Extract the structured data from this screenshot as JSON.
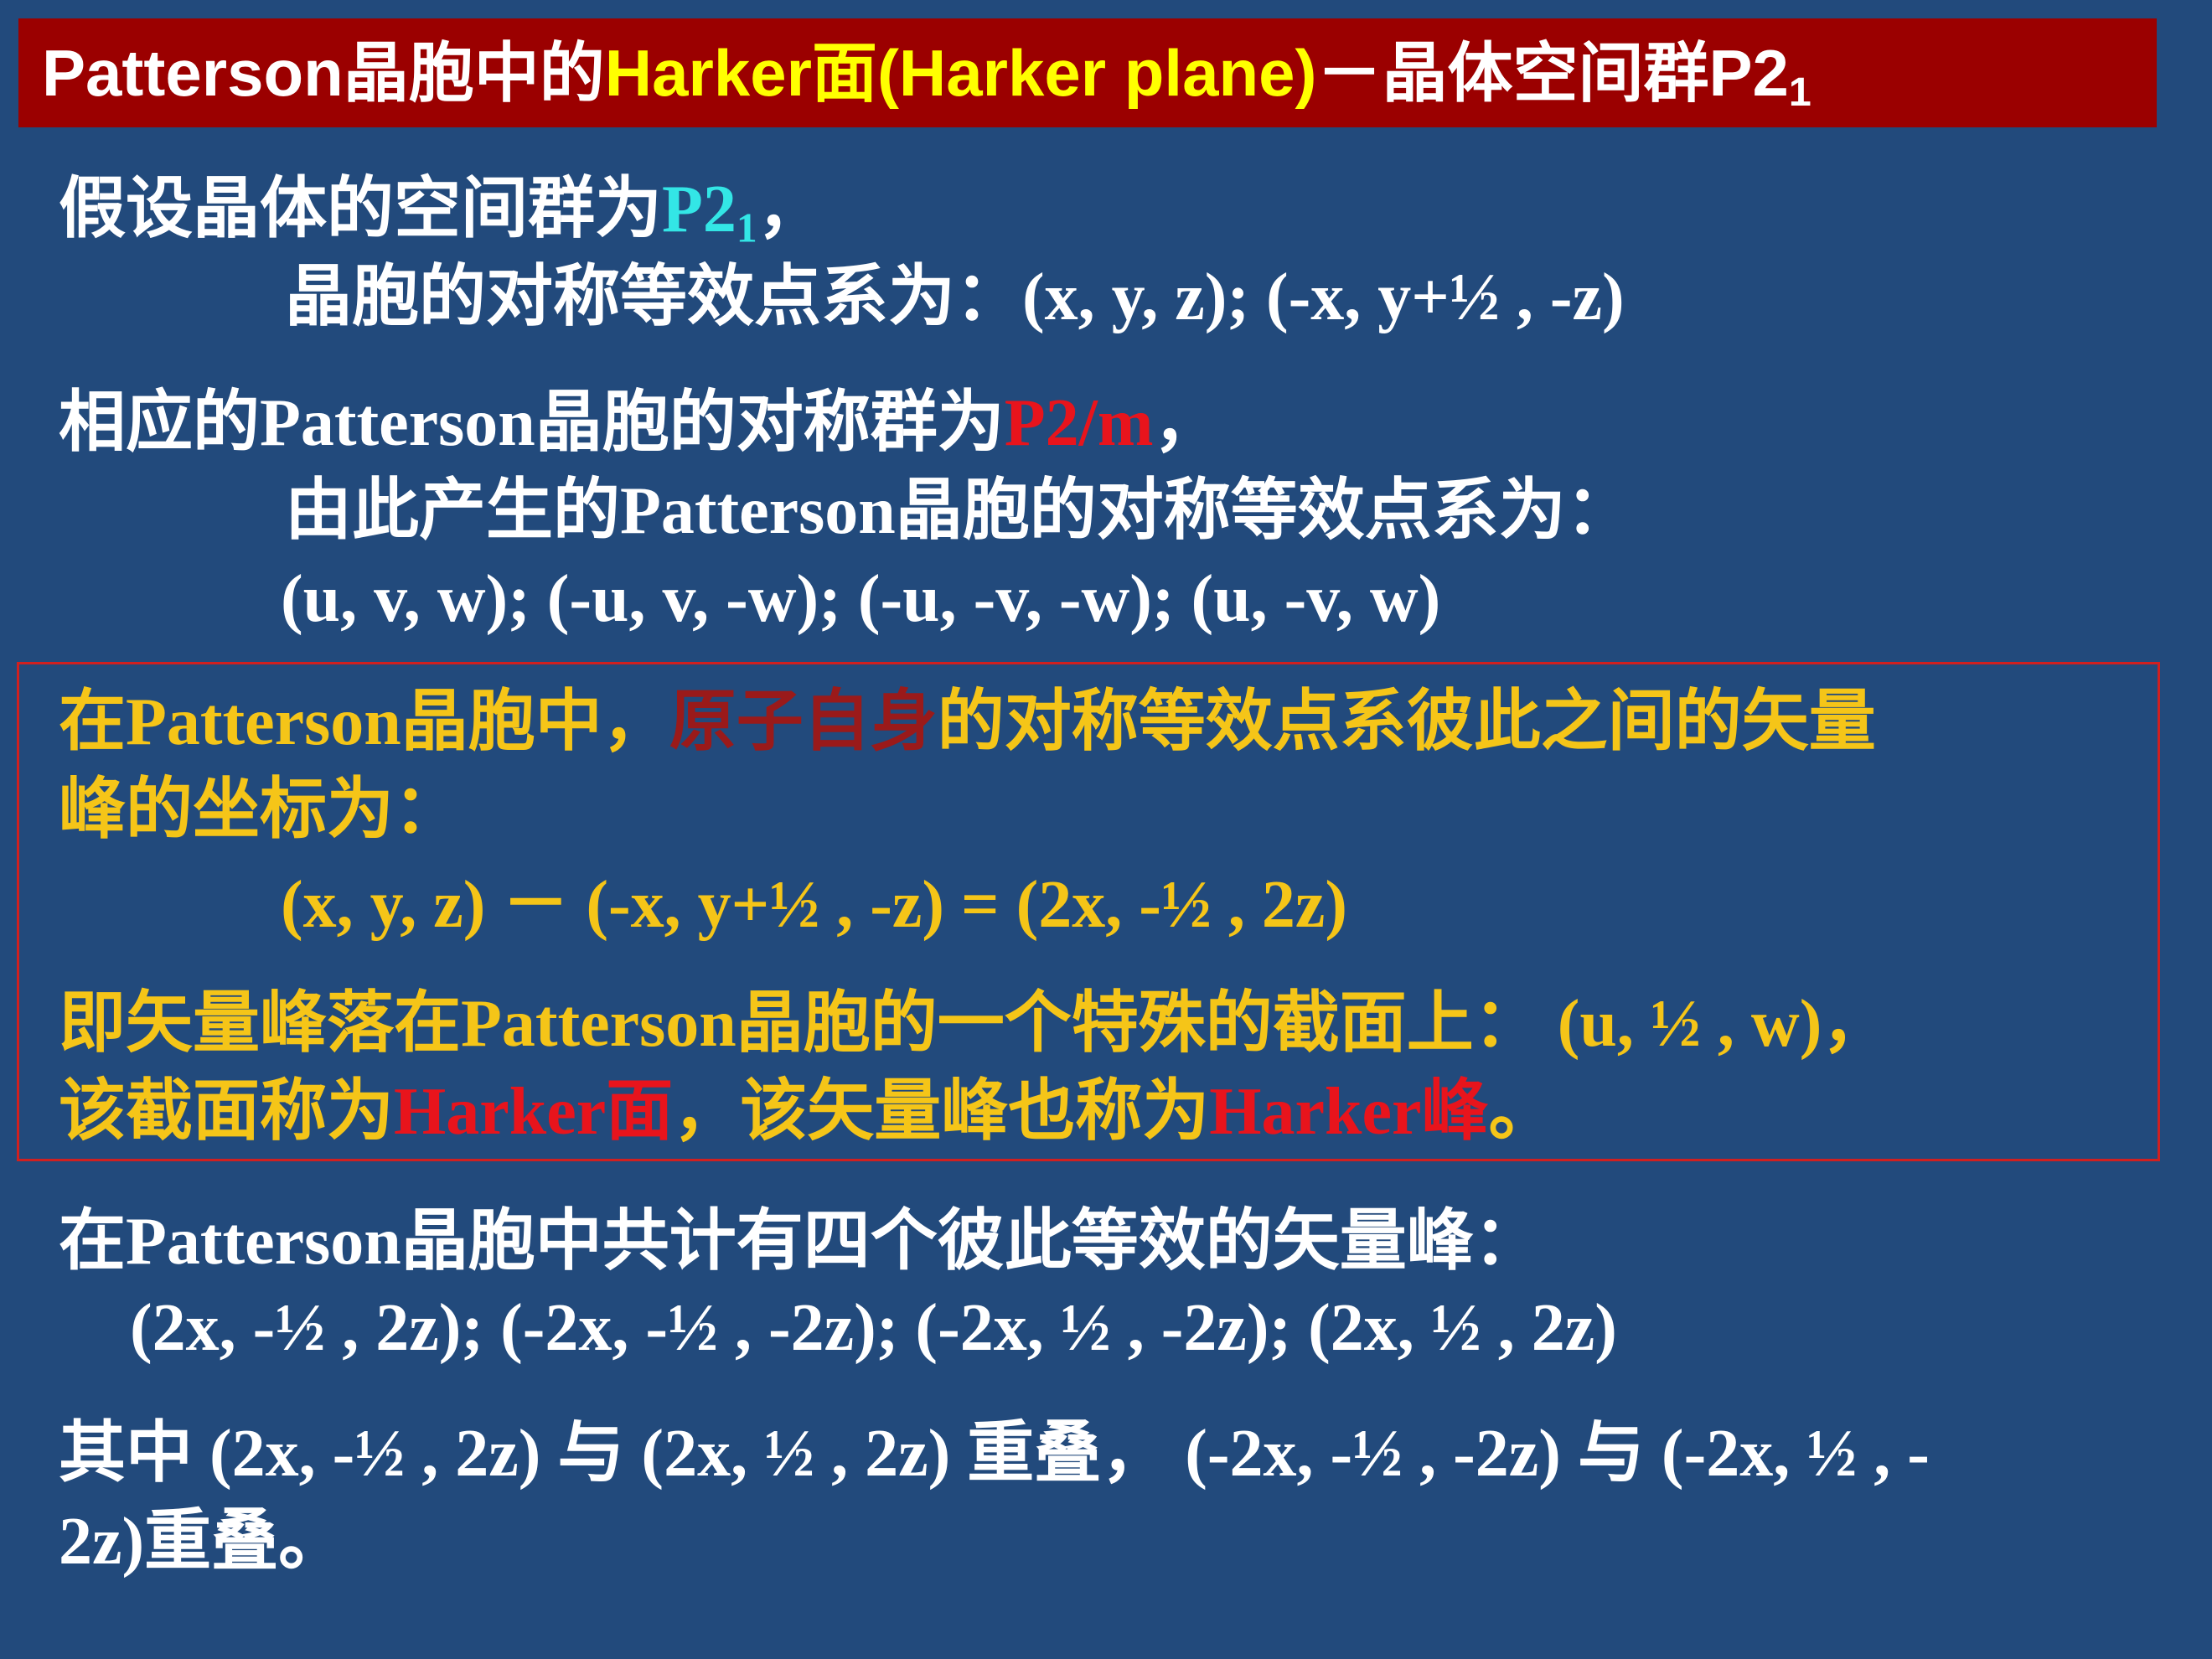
{
  "title": {
    "part1": "Patterson晶胞中的",
    "part2": "Harker面(Harker plane)",
    "part3": "－晶体空间群P2",
    "part3_sub": "1"
  },
  "block1": {
    "line1_text": "假设晶体的空间群为",
    "line1_highlight": "P2",
    "line1_highlight_sub": "1",
    "line1_end": "，",
    "line2": "晶胞的对称等效点系为：(x, y, z); (-x, y+½ , -z)"
  },
  "block2": {
    "line1_text": "相应的Patterson晶胞的对称群为",
    "line1_highlight": "P2/m",
    "line1_end": "，",
    "line2": "由此产生的Patterson晶胞的对称等效点系为：",
    "line3": "(u, v, w);  (-u, v, -w); (-u, -v, -w);  (u, -v, w)"
  },
  "boxed": {
    "line1_a": "在Patterson晶胞中，",
    "line1_highlight": "原子自身",
    "line1_b": "的对称等效点系彼此之间的矢量",
    "line2": "峰的坐标为：",
    "line3": "(x, y, z) － (-x, y+½ , -z) = (2x, -½ , 2z)",
    "line4": "即矢量峰落在Patterson晶胞的一个特殊的截面上： (u, ½ , w)，",
    "line5_a": "该截面称为",
    "line5_highlight1": "Harker面",
    "line5_b": "，该矢量峰也称为",
    "line5_highlight2": "Harker峰",
    "line5_c": "。"
  },
  "block3": {
    "line1": "在Patterson晶胞中共计有四个彼此等效的矢量峰：",
    "line2": "(2x, -½ , 2z);  (-2x, -½ , -2z);  (-2x, ½ , -2z);   (2x, ½ , 2z)"
  },
  "block4": {
    "line1": "其中 (2x, -½ , 2z) 与 (2x, ½ , 2z) 重叠，  (-2x, -½ , -2z) 与 (-2x, ½ , -",
    "line2": "2z)重叠。"
  },
  "colors": {
    "background": "#224a7c",
    "title_bar": "#9b0000",
    "title_highlight": "#ffff00",
    "text": "#ffffff",
    "boxed_text": "#f5c518",
    "highlight_cyan": "#33e6e6",
    "highlight_red": "#e8141c",
    "box_border": "#d02020"
  }
}
